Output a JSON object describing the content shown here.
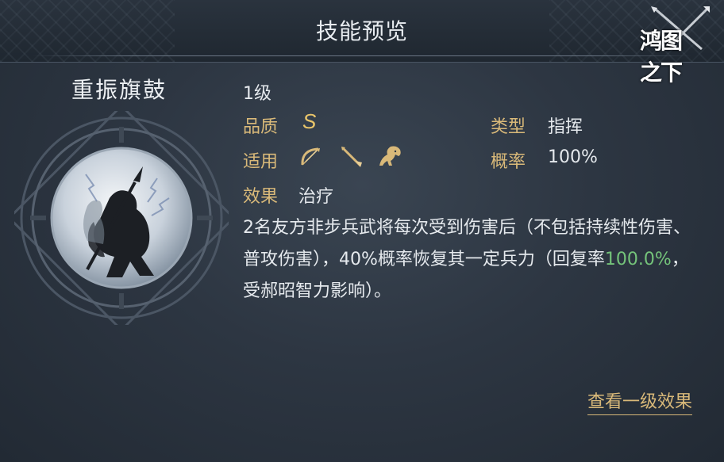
{
  "header": {
    "title": "技能预览",
    "logo_text": "鸿图之下"
  },
  "skill": {
    "name": "重振旗鼓",
    "level": "1级",
    "quality_label": "品质",
    "quality_value": "S",
    "type_label": "类型",
    "type_value": "指挥",
    "applicable_label": "适用",
    "applicable_units": [
      "bow-icon",
      "spear-icon",
      "horse-icon"
    ],
    "probability_label": "概率",
    "probability_value": "100%",
    "effect_label": "效果",
    "effect_value": "治疗",
    "description_part1": "2名友方非步兵武将每次受到伤害后（不包括持续性伤害、普攻伤害），40%概率恢复其一定兵力（回复率",
    "description_highlight": "100.0%",
    "description_part2": "，受郝昭智力影响）。"
  },
  "footer": {
    "view_level1_effect": "查看一级效果"
  },
  "colors": {
    "label_gold": "#d9b979",
    "highlight_green": "#74c37a",
    "text": "#e5e9ed",
    "background": "#2d3642"
  }
}
